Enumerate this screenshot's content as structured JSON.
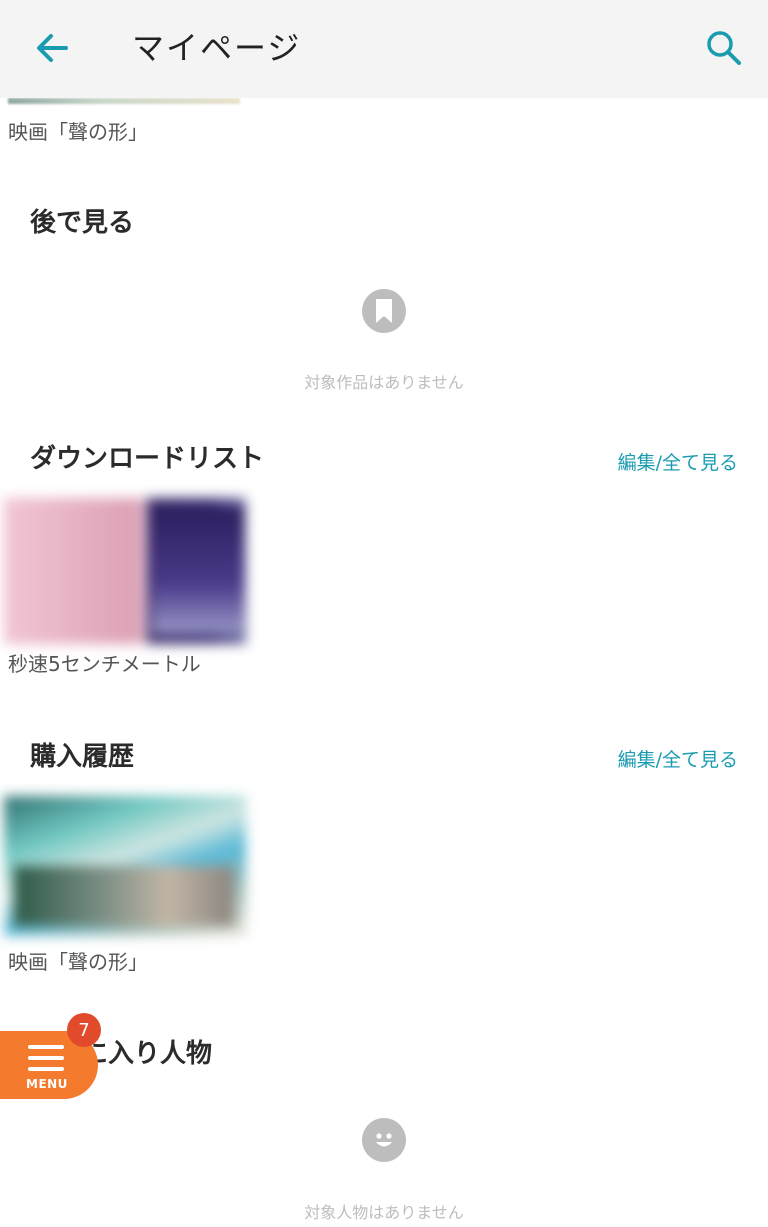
{
  "appbar": {
    "title": "マイページ",
    "back_icon": "arrow-left-icon",
    "search_icon": "search-icon",
    "accent_color": "#1a9bb0"
  },
  "top_item": {
    "caption": "映画「聲の形」"
  },
  "watch_later": {
    "title": "後で見る",
    "empty_icon": "bookmark-icon",
    "empty_text": "対象作品はありません"
  },
  "download_list": {
    "title": "ダウンロードリスト",
    "edit_link": "編集/全て見る",
    "items": [
      {
        "caption": "秒速5センチメートル"
      }
    ]
  },
  "purchase_history": {
    "title": "購入履歴",
    "edit_link": "編集/全て見る",
    "items": [
      {
        "caption": "映画「聲の形」"
      }
    ]
  },
  "favorite_people": {
    "title": "お気に入り人物",
    "empty_icon": "smiley-icon",
    "empty_text": "対象人物はありません"
  },
  "menu": {
    "label": "MENU",
    "badge": "7",
    "color": "#f47a2e",
    "badge_color": "#e14b2b"
  }
}
